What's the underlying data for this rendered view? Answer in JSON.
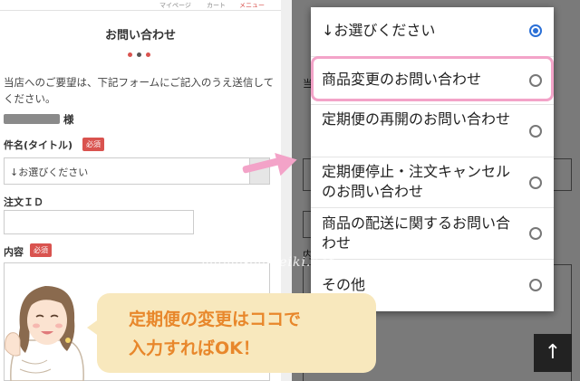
{
  "top_nav": [
    "マイページ",
    "カート",
    "メニュー"
  ],
  "form": {
    "title": "お問い合わせ",
    "intro": "当店へのご要望は、下記フォームにご記入のうえ送信してください。",
    "sama": "様",
    "fields": [
      {
        "label": "件名(タイトル)",
        "required": "必須"
      },
      {
        "label": "注文ＩＤ"
      },
      {
        "label": "内容",
        "required": "必須"
      }
    ],
    "select_value": "↓お選びください",
    "dot_colors": [
      "#d9534f",
      "#555555",
      "#d9534f"
    ]
  },
  "right_behind": {
    "partial_text": "当",
    "label_partial": "内"
  },
  "dropdown": {
    "options": [
      {
        "text": "↓お選びください",
        "selected": true
      },
      {
        "text": "商品変更のお問い合わせ",
        "selected": false,
        "highlighted": true
      },
      {
        "text": "定期便の再開のお問い合わせ",
        "selected": false
      },
      {
        "text": "定期便停止・注文キャンセルのお問い合わせ",
        "selected": false
      },
      {
        "text": "商品の配送に関するお問い合わせ",
        "selected": false
      },
      {
        "text": "その他",
        "selected": false
      }
    ]
  },
  "watermark": "mama-ga-seiki.net",
  "bubble": {
    "text": "定期便の変更はココで\n入力すればOK！"
  },
  "colors": {
    "highlight": "#f3a3c8",
    "required_badge": "#d9534f",
    "bubble_bg": "#f8e8bd",
    "bubble_text": "#e8872b",
    "radio_selected": "#2a6fd6"
  },
  "icons": {
    "back_to_top": "arrow-up-icon"
  }
}
